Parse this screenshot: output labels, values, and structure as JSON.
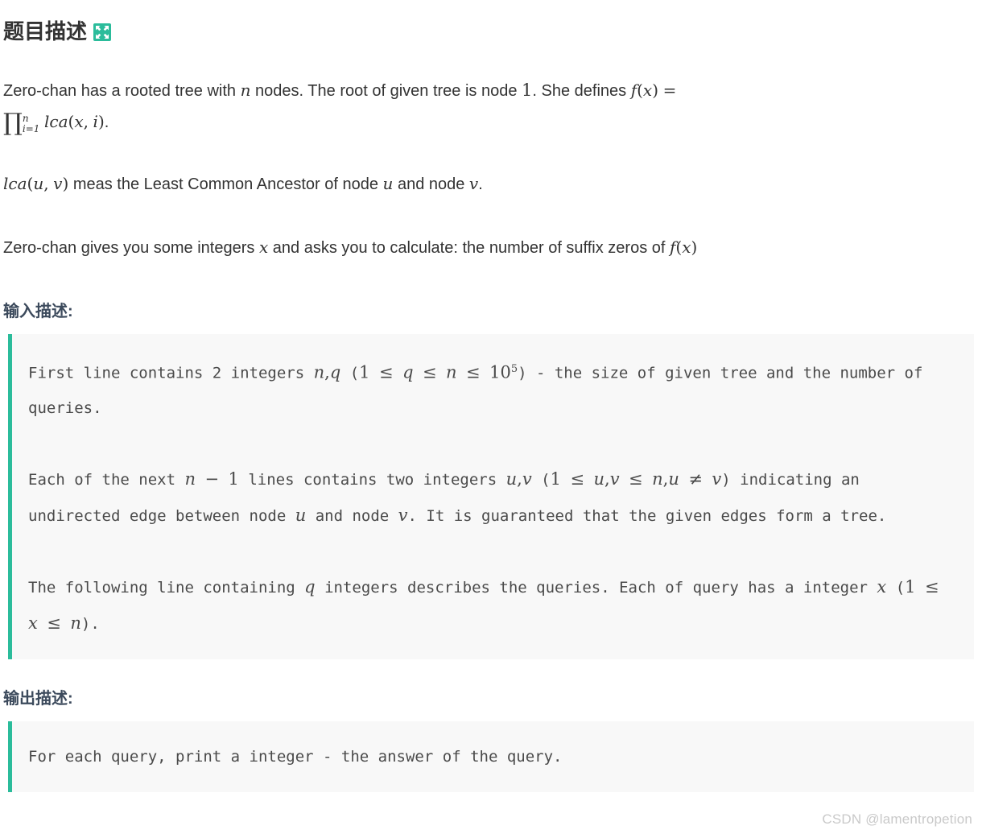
{
  "title": {
    "text": "题目描述",
    "icon": "expand-arrows-icon",
    "icon_color": "#2bbc9b"
  },
  "description": {
    "paragraph1": {
      "segment1": "Zero-chan has a rooted tree with ",
      "math_n": "n",
      "segment2": " nodes. The root of given tree is node ",
      "math_one": "1",
      "segment3": ". She defines ",
      "math_f": "f",
      "math_open": "(",
      "math_x": "x",
      "math_close": ")",
      "math_eq": "=",
      "prod_symbol": "∏",
      "prod_sup": "n",
      "prod_sub": "i=1",
      "math_lca": "lca",
      "math_lca_args_open": "(",
      "math_lca_x": "x",
      "math_comma": ",",
      "math_lca_i": "i",
      "math_lca_args_close": ")",
      "trailing": "."
    },
    "paragraph2": {
      "math_lca": "lca",
      "math_open": "(",
      "math_u": "u",
      "math_comma": ",",
      "math_v": "v",
      "math_close": ")",
      "segment1": " meas the Least Common Ancestor of node ",
      "math_u2": "u",
      "segment2": " and node ",
      "math_v2": "v",
      "segment3": "."
    },
    "paragraph3": {
      "segment1": "Zero-chan gives you some integers ",
      "math_x": "x",
      "segment2": " and asks you to calculate: the number of suffix zeros of ",
      "math_f": "f",
      "math_open": "(",
      "math_x2": "x",
      "math_close": ")"
    }
  },
  "input_section": {
    "heading": "输入描述:",
    "code": {
      "para1": {
        "t1": "First line contains 2 integers ",
        "m_n": "n",
        "m_comma": ",",
        "m_q": "q",
        "t2": " (",
        "m_1": "1",
        "m_le1": "≤",
        "m_q2": "q",
        "m_le2": "≤",
        "m_n2": "n",
        "m_le3": "≤",
        "m_10": "10",
        "m_sup": "5",
        "t3": ") - the size of given tree and the number of queries."
      },
      "para2": {
        "t1": "Each of the next ",
        "m_n": "n",
        "m_minus": "−",
        "m_1": "1",
        "t2": " lines contains two integers ",
        "m_u": "u",
        "m_comma": ",",
        "m_v": "v",
        "t3": " (",
        "m_1b": "1",
        "m_le1": "≤",
        "m_u2": "u",
        "m_comma2": ",",
        "m_v2": "v",
        "m_le2": "≤",
        "m_n2": "n",
        "m_comma3": ",",
        "m_u3": "u",
        "m_neq": "≠",
        "m_v3": "v",
        "t4": ") indicating an undirected edge between node ",
        "m_u4": "u",
        "t5": " and node ",
        "m_v4": "v",
        "t6": ". It is guaranteed that the given edges form a tree."
      },
      "para3": {
        "t1": "The following line containing ",
        "m_q": "q",
        "t2": " integers describes the queries. Each of query has a integer ",
        "m_x": "x",
        "t3": " (",
        "m_1": "1",
        "m_le1": "≤",
        "m_x2": "x",
        "m_le2": "≤",
        "m_n": "n",
        "t4": ")."
      }
    }
  },
  "output_section": {
    "heading": "输出描述:",
    "code": {
      "para1": "For each query, print a integer - the answer of the query."
    }
  },
  "watermark": "CSDN @lamentropetion",
  "colors": {
    "accent_teal": "#2bbc9b",
    "heading_slate": "#3c4a5c",
    "code_bg": "#f8f8f8",
    "body_text": "#333333",
    "watermark": "#c9c9c9"
  }
}
